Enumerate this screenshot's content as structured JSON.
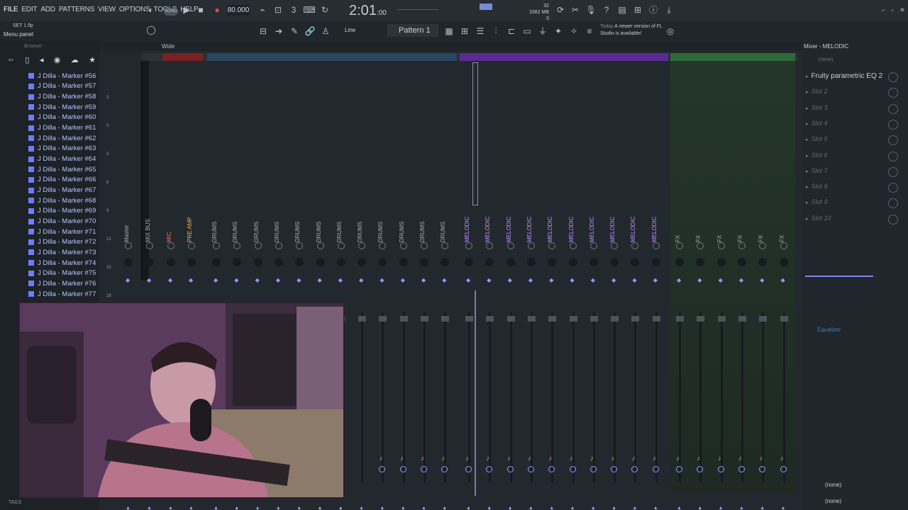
{
  "menu": {
    "items": [
      "FILE",
      "EDIT",
      "ADD",
      "PATTERNS",
      "VIEW",
      "OPTIONS",
      "TOOLS",
      "HELP"
    ],
    "song_mode": "SONG",
    "tempo": "80.000",
    "time_main": "2:01",
    "time_sub": ":00",
    "memory": "1562 MB",
    "memory_top": "32",
    "memory_bottom": "0"
  },
  "subbar": {
    "file_label": "SET 1.flp",
    "hint": "Menu panel",
    "snap": "Line",
    "pattern": "Pattern 1",
    "news_day": "Today",
    "news_text": "A newer version of FL Studio is available!"
  },
  "browser": {
    "title": "Browser",
    "items": [
      "J Dilla - Marker #56",
      "J Dilla - Marker #57",
      "J Dilla - Marker #58",
      "J Dilla - Marker #59",
      "J Dilla - Marker #60",
      "J Dilla - Marker #61",
      "J Dilla - Marker #62",
      "J Dilla - Marker #63",
      "J Dilla - Marker #64",
      "J Dilla - Marker #65",
      "J Dilla - Marker #66",
      "J Dilla - Marker #67",
      "J Dilla - Marker #68",
      "J Dilla - Marker #69",
      "J Dilla - Marker #70",
      "J Dilla - Marker #71",
      "J Dilla - Marker #72",
      "J Dilla - Marker #73",
      "J Dilla - Marker #74",
      "J Dilla - Marker #75",
      "J Dilla - Marker #76",
      "J Dilla - Marker #77"
    ],
    "tags_label": "TAGS"
  },
  "mixer": {
    "width_mode": "Wide",
    "scale": [
      "3",
      "0",
      "3",
      "6",
      "9",
      "12",
      "15",
      "18"
    ],
    "strips": [
      {
        "name": "Master",
        "color": "grey"
      },
      {
        "name": "MIX BUS",
        "color": "grey"
      },
      {
        "name": "MIC",
        "color": "red"
      },
      {
        "name": "PRE AMP",
        "color": "orange"
      },
      {
        "name": "DRUMS",
        "color": "grey"
      },
      {
        "name": "DRUMS",
        "color": "grey"
      },
      {
        "name": "DRUMS",
        "color": "grey"
      },
      {
        "name": "DRUMS",
        "color": "grey"
      },
      {
        "name": "DRUMS",
        "color": "grey"
      },
      {
        "name": "DRUMS",
        "color": "grey"
      },
      {
        "name": "DRUMS",
        "color": "grey"
      },
      {
        "name": "DRUMS",
        "color": "grey"
      },
      {
        "name": "DRUMS",
        "color": "grey"
      },
      {
        "name": "DRUMS",
        "color": "grey"
      },
      {
        "name": "DRUMS",
        "color": "grey"
      },
      {
        "name": "DRUMS",
        "color": "grey"
      },
      {
        "name": "MELODIC",
        "color": "purple"
      },
      {
        "name": "MELODIC",
        "color": "purple"
      },
      {
        "name": "MELODIC",
        "color": "purple"
      },
      {
        "name": "MELODIC",
        "color": "purple"
      },
      {
        "name": "MELODIC",
        "color": "purple"
      },
      {
        "name": "MELODIC",
        "color": "purple"
      },
      {
        "name": "MELODIC",
        "color": "purple"
      },
      {
        "name": "MELODIC",
        "color": "purple"
      },
      {
        "name": "MELODIC",
        "color": "purple"
      },
      {
        "name": "MELODIC",
        "color": "purple"
      },
      {
        "name": "FX",
        "color": "grey"
      },
      {
        "name": "FX",
        "color": "grey"
      },
      {
        "name": "FX",
        "color": "grey"
      },
      {
        "name": "FX",
        "color": "grey"
      },
      {
        "name": "FX",
        "color": "grey"
      },
      {
        "name": "FX",
        "color": "grey"
      }
    ],
    "selected_track": "23"
  },
  "fx_panel": {
    "title": "Mixer - MELODIC",
    "input": "(none)",
    "slots": [
      "Fruity parametric EQ 2",
      "Slot 2",
      "Slot 3",
      "Slot 4",
      "Slot 5",
      "Slot 6",
      "Slot 7",
      "Slot 8",
      "Slot 9",
      "Slot 10"
    ],
    "eq_label": "Equalizer",
    "out_1": "(none)",
    "out_2": "(none)"
  },
  "colors": {
    "accent": "#8f9bff",
    "melodic": "#5b2b92",
    "drums": "#2a4660",
    "fx": "#2d6a38",
    "mic": "#7a1f22"
  }
}
